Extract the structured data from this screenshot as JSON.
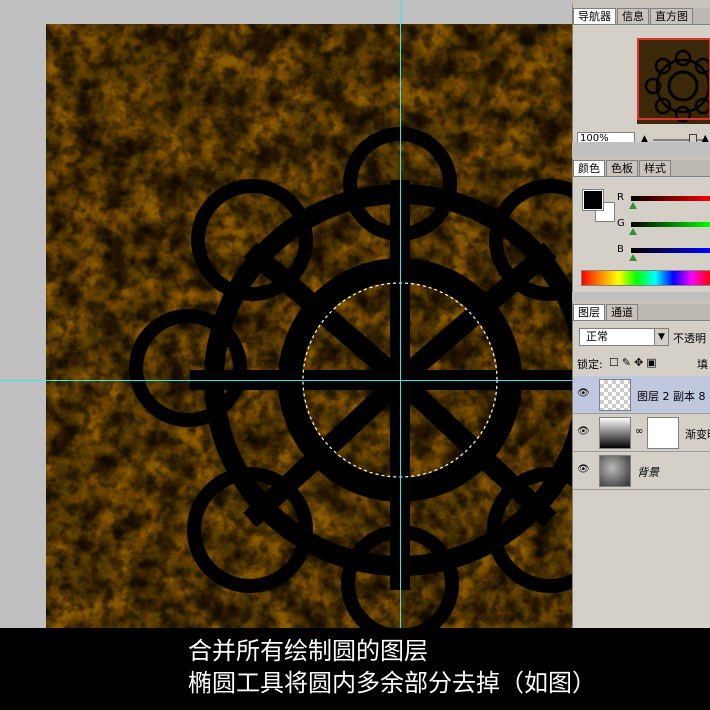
{
  "navigator": {
    "tabs": [
      "导航器",
      "信息",
      "直方图"
    ],
    "zoom": "100%",
    "zoom_out_icon": "small-mountain-icon",
    "zoom_in_icon": "large-mountain-icon"
  },
  "color_panel": {
    "tabs": [
      "颜色",
      "色板",
      "样式"
    ],
    "channels": [
      "R",
      "G",
      "B"
    ],
    "foreground": "#000000",
    "background": "#ffffff"
  },
  "layers_panel": {
    "tabs": [
      "图层",
      "通道"
    ],
    "blend_mode": "正常",
    "opacity_label": "不透明",
    "lock_label": "锁定:",
    "fill_label": "填",
    "layers": [
      {
        "name": "图层 2 副本 8",
        "selected": true
      },
      {
        "name": "渐变映射",
        "selected": false
      },
      {
        "name": "背景",
        "selected": false
      }
    ]
  },
  "caption": {
    "line1": "合并所有绘制圆的图层",
    "line2": "椭圆工具将圆内多余部分去掉（如图）"
  },
  "colors": {
    "texture_base": "#8a5a00",
    "guide": "#38e8e8",
    "shape": "#000000"
  }
}
